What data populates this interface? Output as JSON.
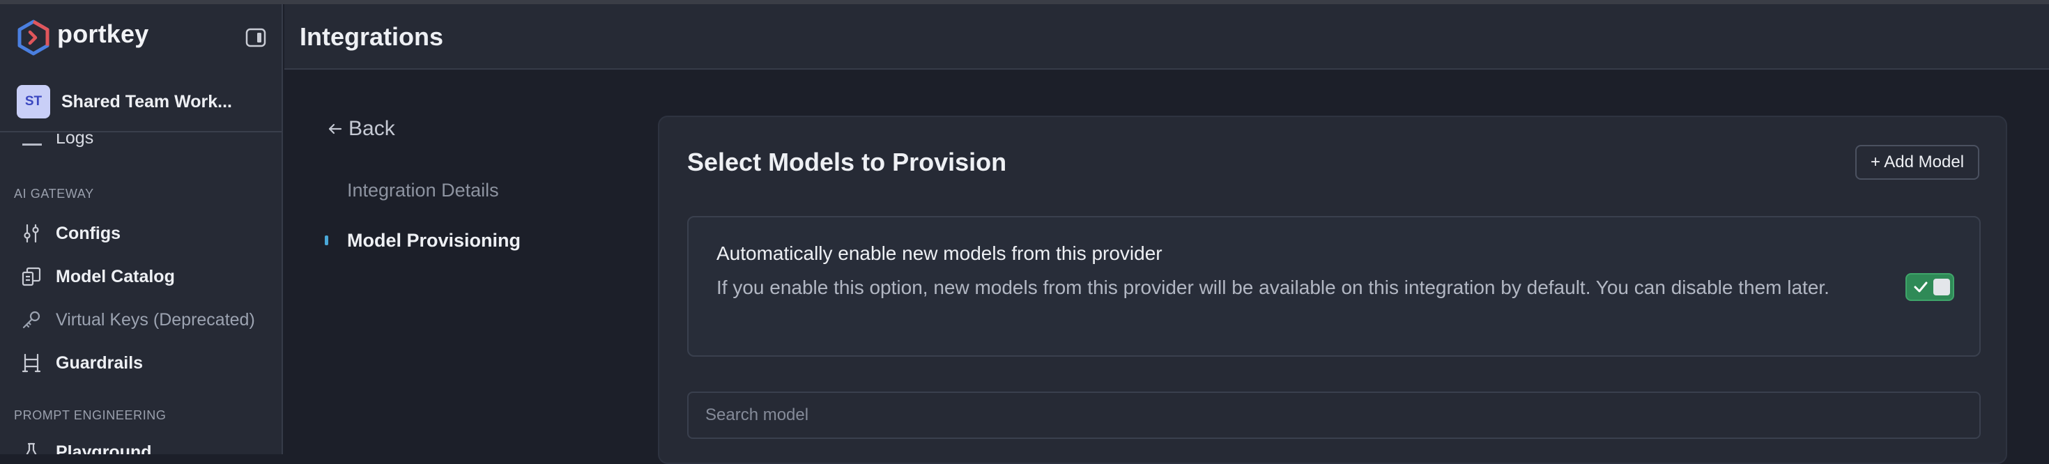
{
  "brand": {
    "name": "portkey"
  },
  "workspace": {
    "initials": "ST",
    "name": "Shared Team Work..."
  },
  "sidebar": {
    "cut_item_label": "Logs",
    "sections": [
      {
        "title": "AI GATEWAY"
      },
      {
        "title": "PROMPT ENGINEERING"
      }
    ],
    "items": [
      {
        "label": "Configs",
        "icon": "sliders-icon"
      },
      {
        "label": "Model Catalog",
        "icon": "catalog-icon"
      },
      {
        "label": "Virtual Keys (Deprecated)",
        "icon": "key-icon"
      },
      {
        "label": "Guardrails",
        "icon": "guardrails-icon"
      },
      {
        "label": "Playground",
        "icon": "flask-icon"
      }
    ]
  },
  "header": {
    "title": "Integrations"
  },
  "subnav": {
    "back_label": "Back",
    "steps": [
      {
        "label": "Integration Details",
        "active": false
      },
      {
        "label": "Model Provisioning",
        "active": true
      }
    ]
  },
  "main": {
    "title": "Select Models to Provision",
    "add_model_label": "+ Add Model",
    "auto_enable": {
      "title": "Automatically enable new models from this provider",
      "description": "If you enable this option, new models from this provider will be available on this integration by default. You can disable them later.",
      "enabled": true
    },
    "search": {
      "placeholder": "Search model",
      "value": ""
    }
  },
  "colors": {
    "background": "#1c1f29",
    "panel": "#262a35",
    "toggle_on": "#2f8a57",
    "active_marker": "#4aa8d8",
    "avatar_bg": "#c9cff7"
  }
}
